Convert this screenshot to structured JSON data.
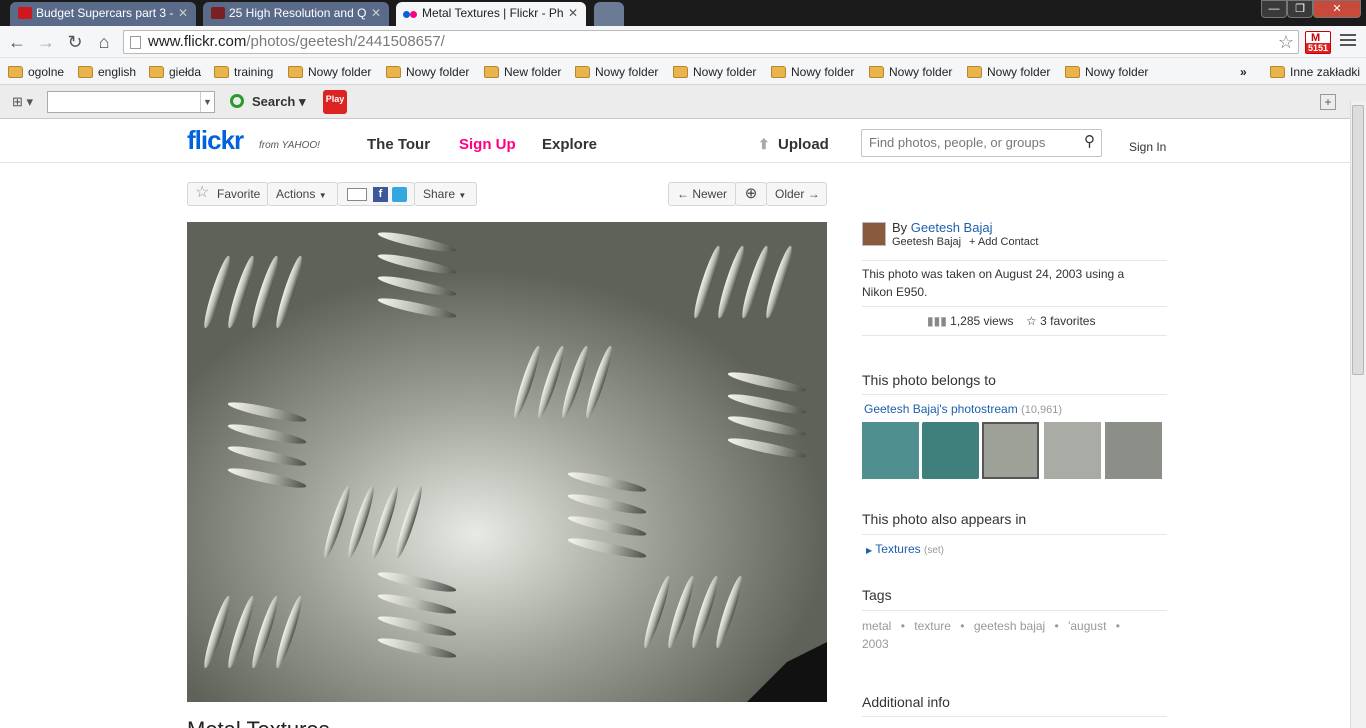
{
  "browser": {
    "tabs": [
      {
        "title": "Budget Supercars part 3 -",
        "fav_color": "#cc181e"
      },
      {
        "title": "25 High Resolution and Q",
        "fav_color": "#7a2020"
      },
      {
        "title": "Metal Textures | Flickr - Ph",
        "fav_color": "#ff0084"
      }
    ],
    "url_host": "www.flickr.com",
    "url_path": "/photos/geetesh/2441508657/",
    "gmail_count": "5151",
    "bookmarks": [
      "ogolne",
      "english",
      "giełda",
      "training",
      "Nowy folder",
      "Nowy folder",
      "New folder",
      "Nowy folder",
      "Nowy folder",
      "Nowy folder",
      "Nowy folder",
      "Nowy folder",
      "Nowy folder"
    ],
    "bookmarks_more": "»",
    "other_bookmarks": "Inne zakładki",
    "ext_search_label": "Search",
    "play_label": "Play"
  },
  "flickr": {
    "logo": "flickr",
    "logo_sub": "from YAHOO!",
    "nav": {
      "tour": "The Tour",
      "signup": "Sign Up",
      "explore": "Explore",
      "upload": "Upload",
      "signin": "Sign In"
    },
    "search_placeholder": "Find photos, people, or groups",
    "actions": {
      "favorite": "Favorite",
      "actions": "Actions",
      "share": "Share",
      "newer": "Newer",
      "older": "Older"
    },
    "photo_title": "Metal Textures",
    "owner": {
      "by": "By",
      "name": "Geetesh Bajaj",
      "sub": "Geetesh Bajaj",
      "add_contact": "+ Add Contact"
    },
    "taken_text": "This photo was taken on August 24, 2003 using a Nikon E950.",
    "views": "1,285 views",
    "favorites": "3 favorites",
    "belongs_heading": "This photo belongs to",
    "photostream": "Geetesh Bajaj's photostream",
    "photostream_count": "(10,961)",
    "appears_heading": "This photo also appears in",
    "set_name": "Textures",
    "set_tag": "(set)",
    "tags_heading": "Tags",
    "tags": [
      "metal",
      "texture",
      "geetesh bajaj",
      "'august",
      "2003"
    ],
    "additional_heading": "Additional info"
  }
}
